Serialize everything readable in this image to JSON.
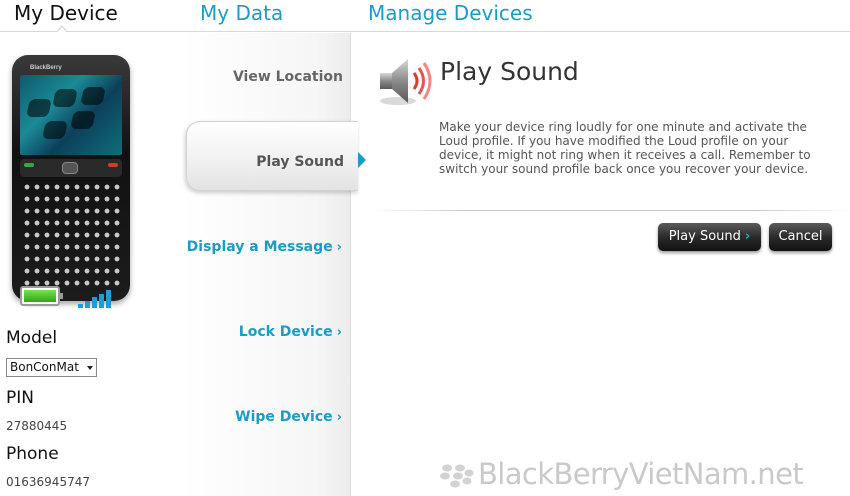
{
  "nav": {
    "tabs": [
      {
        "label": "My Device",
        "active": true
      },
      {
        "label": "My Data",
        "active": false
      },
      {
        "label": "Manage Devices",
        "active": false
      }
    ]
  },
  "device": {
    "battery_level": 1.0,
    "signal_bars": 5,
    "model_label": "Model",
    "model_select_value": "BonConMat",
    "pin_label": "PIN",
    "pin_value": "27880445",
    "phone_label": "Phone",
    "phone_value": "01636945747"
  },
  "actions": {
    "view_location": "View Location",
    "play_sound": "Play Sound",
    "display_message": "Display a Message",
    "lock_device": "Lock Device",
    "wipe_device": "Wipe Device",
    "chevron": "›"
  },
  "content": {
    "title": "Play Sound",
    "description": "Make your device ring loudly for one minute and activate the Loud profile. If you have modified the Loud profile on your device, it might not ring when it receives a call. Remember to switch your sound profile back once you recover your device.",
    "play_button": "Play Sound",
    "cancel_button": "Cancel"
  },
  "watermark": "BlackBerryVietNam.net",
  "colors": {
    "accent": "#1a9cc7",
    "button_dark": "#2b2b2b",
    "battery_green": "#2fa61b",
    "speaker_red": "#e03a2e"
  },
  "icons": {
    "speaker": "speaker-icon",
    "battery": "battery-icon",
    "signal": "signal-icon",
    "blackberry": "blackberry-logo-icon"
  }
}
